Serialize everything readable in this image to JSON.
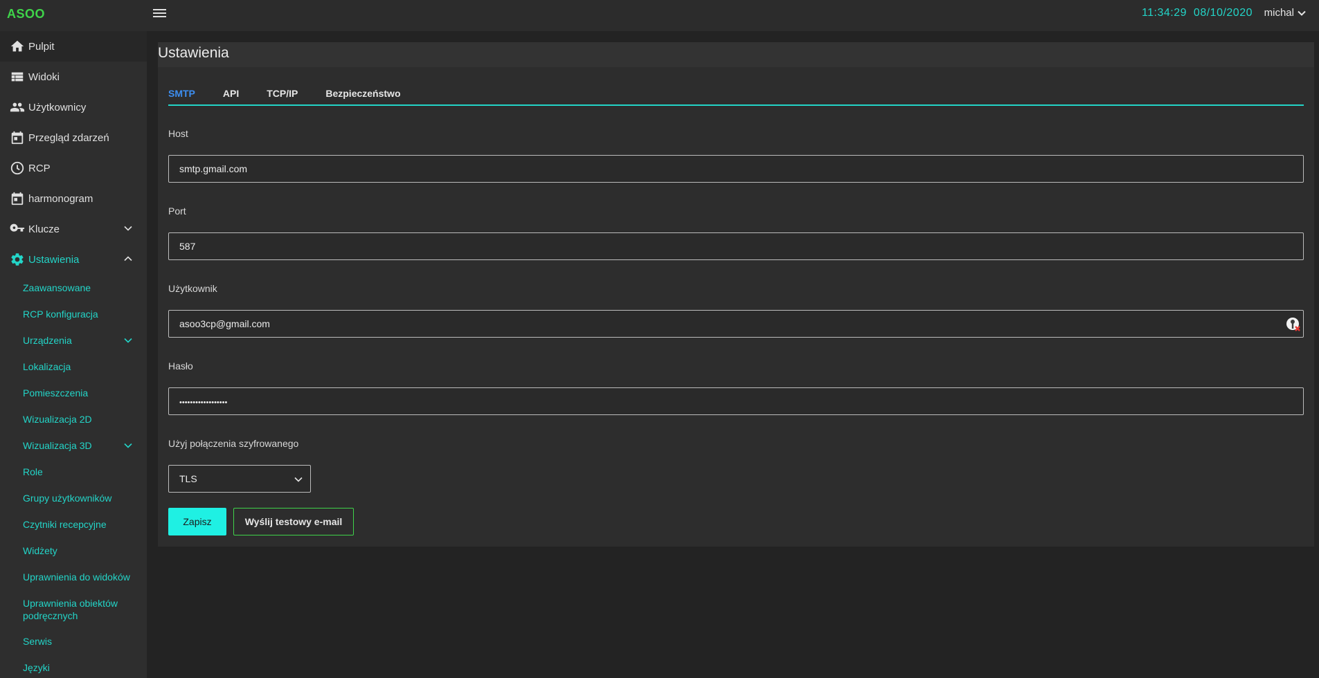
{
  "app": {
    "brand": "ASOO"
  },
  "header": {
    "time": "11:34:29",
    "date": "08/10/2020",
    "user": "michal"
  },
  "sidebar": {
    "items": [
      {
        "label": "Pulpit",
        "icon": "home-icon"
      },
      {
        "label": "Widoki",
        "icon": "view-list-icon"
      },
      {
        "label": "Użytkownicy",
        "icon": "people-icon"
      },
      {
        "label": "Przegląd zdarzeń",
        "icon": "calendar-icon"
      },
      {
        "label": "RCP",
        "icon": "clock-icon"
      },
      {
        "label": "harmonogram",
        "icon": "calendar-icon"
      },
      {
        "label": "Klucze",
        "icon": "key-icon"
      },
      {
        "label": "Ustawienia",
        "icon": "gear-icon"
      }
    ],
    "subitems": [
      {
        "label": "Zaawansowane"
      },
      {
        "label": "RCP konfiguracja"
      },
      {
        "label": "Urządzenia"
      },
      {
        "label": "Lokalizacja"
      },
      {
        "label": "Pomieszczenia"
      },
      {
        "label": "Wizualizacja 2D"
      },
      {
        "label": "Wizualizacja 3D"
      },
      {
        "label": "Role"
      },
      {
        "label": "Grupy użytkowników"
      },
      {
        "label": "Czytniki recepcyjne"
      },
      {
        "label": "Widżety"
      },
      {
        "label": "Uprawnienia do widoków"
      },
      {
        "label": "Uprawnienia obiektów podręcznych"
      },
      {
        "label": "Serwis"
      },
      {
        "label": "Języki"
      }
    ]
  },
  "main": {
    "title": "Ustawienia",
    "tabs": [
      {
        "label": "SMTP"
      },
      {
        "label": "API"
      },
      {
        "label": "TCP/IP"
      },
      {
        "label": "Bezpieczeństwo"
      }
    ],
    "form": {
      "host_label": "Host",
      "host_value": "smtp.gmail.com",
      "port_label": "Port",
      "port_value": "587",
      "user_label": "Użytkownik",
      "user_value": "asoo3cp@gmail.com",
      "password_label": "Hasło",
      "password_value": "••••••••••••••••••",
      "encryption_label": "Użyj połączenia szyfrowanego",
      "encryption_value": "TLS"
    },
    "buttons": {
      "save": "Zapisz",
      "test_email": "Wyślij testowy e-mail"
    }
  },
  "colors": {
    "brand": "#3fd44a",
    "accent": "#23d5c8",
    "active_tab": "#3d8ef0",
    "save_button": "#1ff0e3"
  }
}
